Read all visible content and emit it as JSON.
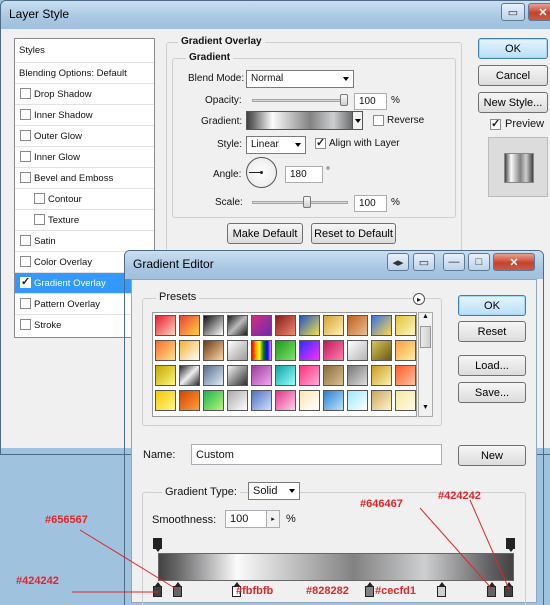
{
  "layer_style": {
    "title": "Layer Style",
    "styles_header": "Styles",
    "items": [
      {
        "label": "Blending Options: Default"
      },
      {
        "label": "Drop Shadow",
        "checked": false
      },
      {
        "label": "Inner Shadow",
        "checked": false
      },
      {
        "label": "Outer Glow",
        "checked": false
      },
      {
        "label": "Inner Glow",
        "checked": false
      },
      {
        "label": "Bevel and Emboss",
        "checked": false
      },
      {
        "label": "Contour",
        "checked": false
      },
      {
        "label": "Texture",
        "checked": false
      },
      {
        "label": "Satin",
        "checked": false
      },
      {
        "label": "Color Overlay",
        "checked": false
      },
      {
        "label": "Gradient Overlay",
        "checked": true
      },
      {
        "label": "Pattern Overlay",
        "checked": false
      },
      {
        "label": "Stroke",
        "checked": false
      }
    ],
    "section_title": "Gradient Overlay",
    "group_title": "Gradient",
    "blend_mode_label": "Blend Mode:",
    "blend_mode_value": "Normal",
    "opacity_label": "Opacity:",
    "opacity_value": "100",
    "opacity_unit": "%",
    "gradient_label": "Gradient:",
    "reverse_label": "Reverse",
    "style_label": "Style:",
    "style_value": "Linear",
    "align_label": "Align with Layer",
    "angle_label": "Angle:",
    "angle_value": "180",
    "angle_unit": "°",
    "scale_label": "Scale:",
    "scale_value": "100",
    "scale_unit": "%",
    "make_default": "Make Default",
    "reset_default": "Reset to Default",
    "ok": "OK",
    "cancel": "Cancel",
    "new_style": "New Style...",
    "preview_label": "Preview"
  },
  "gradient_editor": {
    "title": "Gradient Editor",
    "presets_label": "Presets",
    "ok": "OK",
    "reset": "Reset",
    "load": "Load...",
    "save": "Save...",
    "name_label": "Name:",
    "name_value": "Custom",
    "new_button": "New",
    "gradient_type_label": "Gradient Type:",
    "gradient_type_value": "Solid",
    "smoothness_label": "Smoothness:",
    "smoothness_value": "100",
    "smoothness_unit": "%",
    "preset_swatches": [
      [
        "linear-gradient(135deg,#e4212c,#fbd2c2)",
        "linear-gradient(135deg,#e6423a,#ffd23f)",
        "linear-gradient(135deg,#111,#fff)",
        "linear-gradient(135deg,#1e1e1e,#bbb 50%,#1e1e1e)",
        "linear-gradient(135deg,#d12f7d,#6f2ab2)",
        "linear-gradient(135deg,#8b1a1a,#f08a6f)",
        "linear-gradient(135deg,#2155c3,#f7e04a)",
        "linear-gradient(135deg,#d6a13b,#fff3b0)",
        "linear-gradient(135deg,#c05f22,#e8c08d)",
        "linear-gradient(135deg,#3a72e0,#ffd74c)",
        "linear-gradient(135deg,#e3c23d,#fff7c0)"
      ],
      [
        "linear-gradient(135deg,#fb6d2c,#ffe38a)",
        "linear-gradient(135deg,#f4b02e,#fff)",
        "linear-gradient(135deg,#6b3a1a,#ffd7a6)",
        "linear-gradient(135deg,#ffffff,#9b9b9b)",
        "linear-gradient(90deg,red,orange,yellow,green,blue,violet)",
        "linear-gradient(135deg,#1d9a1d,#7ee46a)",
        "linear-gradient(135deg,#2d2dff,#ff2dff)",
        "linear-gradient(135deg,#c2185b,#ff80ab)",
        "linear-gradient(135deg,#fff,#b5b5b5)",
        "linear-gradient(135deg,#d8c35a,#6a5a12)",
        "linear-gradient(135deg,#ff9f40,#ffef9c)"
      ],
      [
        "linear-gradient(135deg,#c5a800,#fff680)",
        "linear-gradient(135deg,#2a2a2a,#eee 50%,#2a2a2a)",
        "linear-gradient(135deg,#5a6e8c,#e0ecf8)",
        "linear-gradient(135deg,#f3f3f3,#2f2f2f)",
        "linear-gradient(135deg,#9c3c9c,#f0a8f0)",
        "linear-gradient(135deg,#0fa3a3,#9ff)",
        "linear-gradient(135deg,#ff3377,#ffaadd)",
        "linear-gradient(135deg,#8a6d3b,#d9c093)",
        "linear-gradient(135deg,#777,#ddd)",
        "linear-gradient(135deg,#c8a020,#fdf0b0)",
        "linear-gradient(135deg,#ff5b2c,#ffc39c)"
      ],
      [
        "linear-gradient(135deg,#f3c800,#fff58c)",
        "linear-gradient(135deg,#d24600,#ff9e3c)",
        "linear-gradient(135deg,#1db34b,#b8f57d)",
        "linear-gradient(135deg,#aaa,#fff)",
        "linear-gradient(135deg,#5070c0,#cfe0ff)",
        "linear-gradient(135deg,#e0348c,#ffd1e8)",
        "linear-gradient(135deg,#ffe7b3,#fff)",
        "linear-gradient(135deg,#2a80d0,#bde3ff)",
        "linear-gradient(135deg,#9be7ff,#fff)",
        "linear-gradient(135deg,#cba65d,#fff5cc)",
        "linear-gradient(135deg,#f7e7a3,#fffbe3)"
      ]
    ],
    "stops": {
      "colors": [
        "#424242",
        "#656567",
        "#fbfbfb",
        "#828282",
        "#cecfd1",
        "#646467",
        "#424242"
      ]
    },
    "annotations": {
      "c1": "#656567",
      "c2": "#424242",
      "c3": "#fbfbfb",
      "c4": "#828282",
      "c5": "#cecfd1",
      "c6": "#646467",
      "c7": "#424242"
    }
  }
}
